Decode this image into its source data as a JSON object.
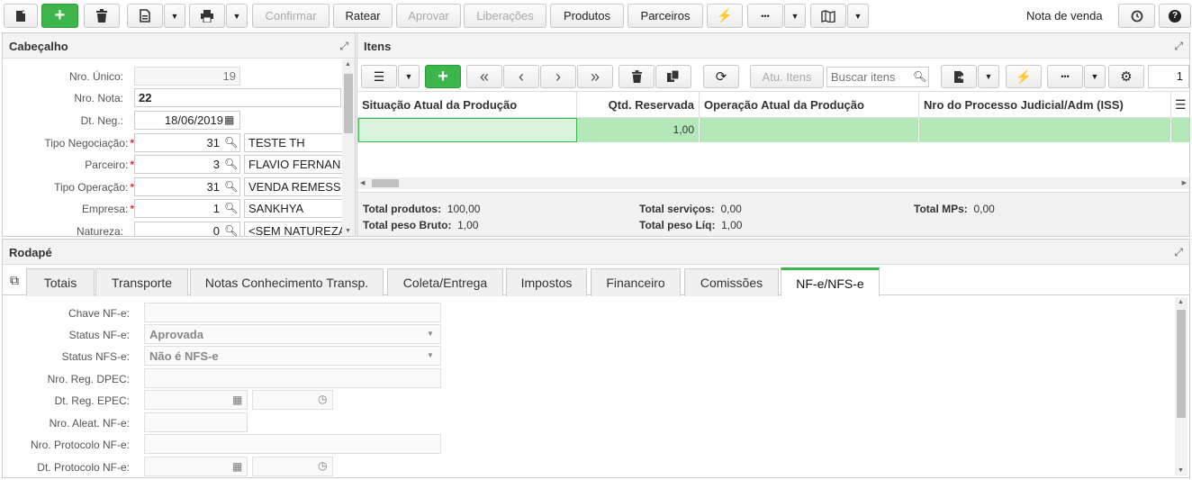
{
  "toolbar": {
    "confirm_label": "Confirmar",
    "ratear_label": "Ratear",
    "approve_label": "Aprovar",
    "releases_label": "Liberações",
    "products_label": "Produtos",
    "partners_label": "Parceiros",
    "more_label": "•••",
    "title": "Nota de venda"
  },
  "header": {
    "title": "Cabeçalho",
    "fields": {
      "nro_unico": {
        "label": "Nro. Único:",
        "value": "19"
      },
      "nro_nota": {
        "label": "Nro. Nota:",
        "value": "22"
      },
      "dt_neg": {
        "label": "Dt. Neg.:",
        "value": "18/06/2019"
      },
      "tipo_negociacao": {
        "label": "Tipo Negociação:",
        "code": "31",
        "desc": "TESTE TH"
      },
      "parceiro": {
        "label": "Parceiro:",
        "code": "3",
        "desc": "FLAVIO FERNAN"
      },
      "tipo_operacao": {
        "label": "Tipo Operação:",
        "code": "31",
        "desc": "VENDA REMESS"
      },
      "empresa": {
        "label": "Empresa:",
        "code": "1",
        "desc": "SANKHYA"
      },
      "natureza": {
        "label": "Natureza:",
        "code": "0",
        "desc": "<SEM NATUREZA"
      }
    },
    "required_mark": "*"
  },
  "items": {
    "title": "Itens",
    "atu_label": "Atu. Itens",
    "search_placeholder": "Buscar itens",
    "page_value": "1",
    "columns": [
      "Situação Atual da Produção",
      "Qtd. Reservada",
      "Operação Atual da Produção",
      "Nro do Processo Judicial/Adm (ISS)"
    ],
    "row": {
      "qtd_reservada": "1,00"
    },
    "totals": {
      "produtos_label": "Total produtos:",
      "produtos_value": "100,00",
      "peso_bruto_label": "Total peso Bruto:",
      "peso_bruto_value": "1,00",
      "servicos_label": "Total serviços:",
      "servicos_value": "0,00",
      "peso_liq_label": "Total peso Líq:",
      "peso_liq_value": "1,00",
      "mps_label": "Total MPs:",
      "mps_value": "0,00"
    }
  },
  "footer": {
    "title": "Rodapé",
    "tabs": [
      "Totais",
      "Transporte",
      "Notas Conhecimento Transp.",
      "Coleta/Entrega",
      "Impostos",
      "Financeiro",
      "Comissões",
      "NF-e/NFS-e"
    ],
    "fields": {
      "chave": {
        "label": "Chave NF-e:"
      },
      "status_nfe": {
        "label": "Status NF-e:",
        "value": "Aprovada"
      },
      "status_nfse": {
        "label": "Status NFS-e:",
        "value": "Não é NFS-e"
      },
      "reg_dpec": {
        "label": "Nro. Reg. DPEC:"
      },
      "dt_epec": {
        "label": "Dt. Reg. EPEC:"
      },
      "aleat": {
        "label": "Nro. Aleat. NF-e:"
      },
      "protocolo": {
        "label": "Nro. Protocolo NF-e:"
      },
      "dt_protocolo": {
        "label": "Dt. Protocolo NF-e:"
      }
    }
  }
}
